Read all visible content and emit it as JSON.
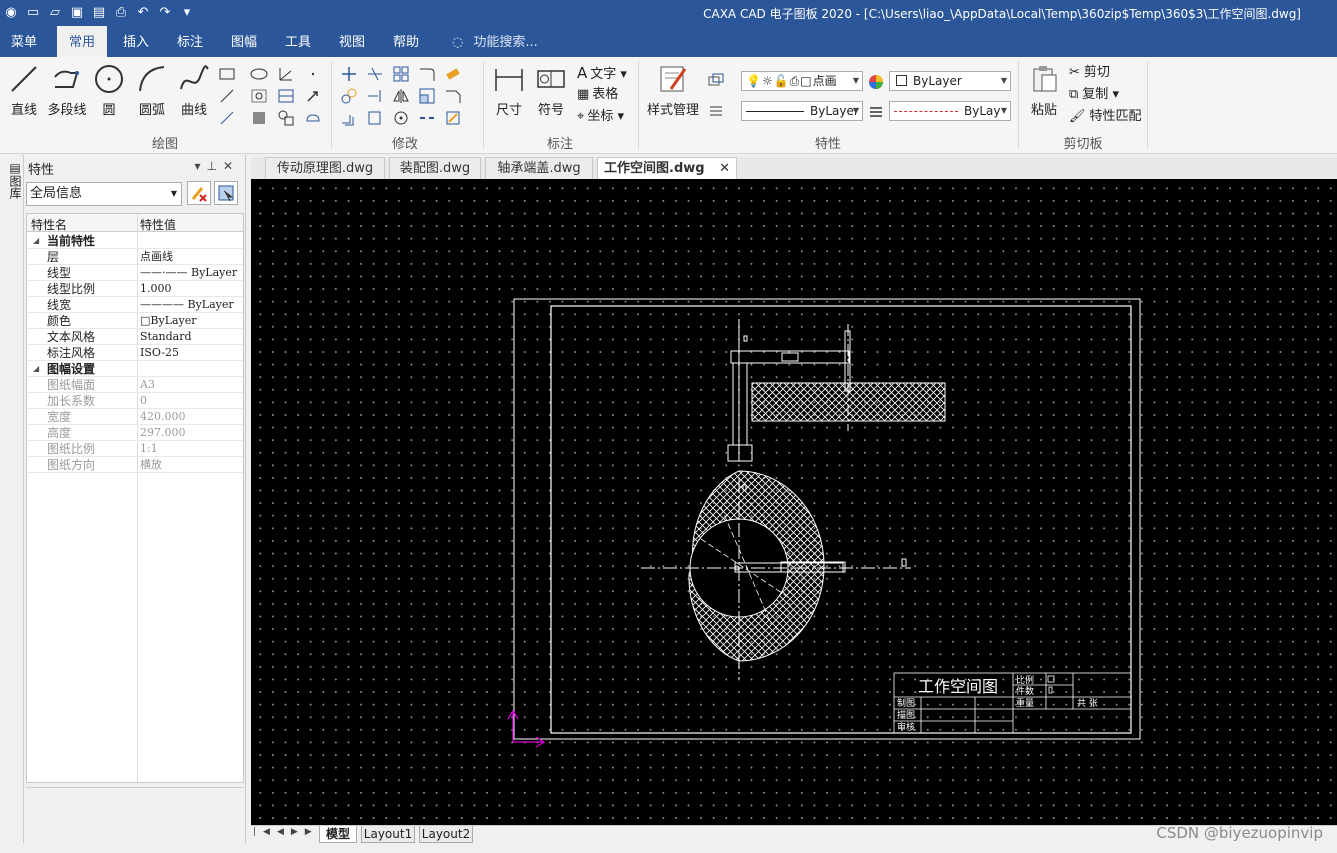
{
  "window": {
    "title": "CAXA CAD 电子图板 2020 - [C:\\Users\\liao_\\AppData\\Local\\Temp\\360zip$Temp\\360$3\\工作空间图.dwg]"
  },
  "menubar": {
    "items": [
      "菜单",
      "常用",
      "插入",
      "标注",
      "图幅",
      "工具",
      "视图",
      "帮助"
    ],
    "active": "常用",
    "search_placeholder": "功能搜索..."
  },
  "ribbon": {
    "draw": {
      "label": "绘图",
      "line": "直线",
      "polyline": "多段线",
      "circle": "圆",
      "arc": "圆弧",
      "curve": "曲线"
    },
    "modify": {
      "label": "修改"
    },
    "annotate": {
      "label": "标注",
      "dimension": "尺寸",
      "symbol": "符号",
      "text": "文字",
      "table": "表格",
      "coordinate": "坐标"
    },
    "properties": {
      "label": "特性",
      "style_manager": "样式管理",
      "layer_combo": "点画",
      "color_combo": "ByLayer",
      "linetype_combo": "ByLayer",
      "linewidth_combo": "ByLay"
    },
    "clipboard": {
      "label": "剪切板",
      "paste": "粘贴",
      "cut": "剪切",
      "copy": "复制",
      "match": "特性匹配"
    }
  },
  "left_strip": {
    "label": "图库"
  },
  "properties_panel": {
    "title": "特性",
    "scope": "全局信息",
    "columns": [
      "特性名",
      "特性值"
    ],
    "sections": [
      {
        "name": "当前特性",
        "rows": [
          {
            "k": "层",
            "v": "点画线"
          },
          {
            "k": "线型",
            "v": "——·—— ByLayer"
          },
          {
            "k": "线型比例",
            "v": "1.000"
          },
          {
            "k": "线宽",
            "v": "———— ByLayer"
          },
          {
            "k": "颜色",
            "v": "□ByLayer"
          },
          {
            "k": "文本风格",
            "v": "Standard"
          },
          {
            "k": "标注风格",
            "v": "ISO-25"
          }
        ]
      },
      {
        "name": "图幅设置",
        "rows": [
          {
            "k": "图纸幅面",
            "v": "A3"
          },
          {
            "k": "加长系数",
            "v": "0"
          },
          {
            "k": "宽度",
            "v": "420.000"
          },
          {
            "k": "高度",
            "v": "297.000"
          },
          {
            "k": "图纸比例",
            "v": "1:1"
          },
          {
            "k": "图纸方向",
            "v": "横放"
          }
        ]
      }
    ]
  },
  "doc_tabs": [
    "传动原理图.dwg",
    "装配图.dwg",
    "轴承端盖.dwg",
    "工作空间图.dwg"
  ],
  "active_doc_tab": "工作空间图.dwg",
  "drawing": {
    "title_block_title": "工作空间图",
    "labels": [
      "比例",
      "件数",
      "重量",
      "共 张",
      "制图",
      "描图",
      "审核"
    ]
  },
  "layout_tabs": [
    "模型",
    "Layout1",
    "Layout2"
  ],
  "active_layout_tab": "模型",
  "watermark": "CSDN @biyezuopinvip",
  "colors": {
    "titlebar": "#2b579a",
    "canvas": "#000000",
    "ucs": "#d400d4"
  }
}
